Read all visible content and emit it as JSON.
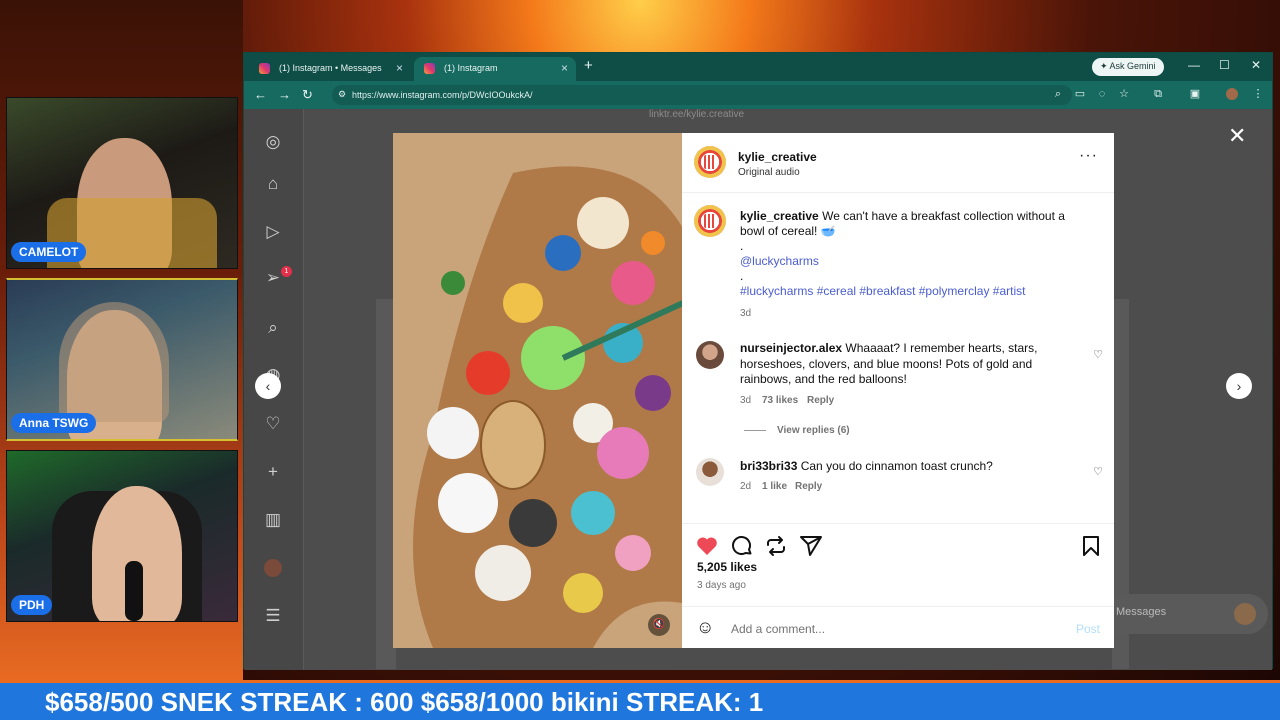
{
  "stream": {
    "cams": [
      {
        "label": "CAMELOT"
      },
      {
        "label": "Anna TSWG"
      },
      {
        "label": "PDH"
      }
    ],
    "ticker": "$658/500 SNEK STREAK : 600 $658/1000 bikini STREAK: 1"
  },
  "browser": {
    "tabs": [
      {
        "title": "(1) Instagram • Messages",
        "active": false
      },
      {
        "title": "(1) Instagram",
        "active": true
      }
    ],
    "new_tab": "+",
    "ask_gemini": "Ask Gemini",
    "url": "https://www.instagram.com/p/DWcIOOukckA/"
  },
  "instagram": {
    "profile_link_partial": "linktr.ee/kylie.creative",
    "notification_count": "1",
    "post": {
      "username": "kylie_creative",
      "audio": "Original audio",
      "caption": {
        "username": "kylie_creative",
        "text": "We can't have a breakfast collection without a bowl of cereal! 🥣",
        "dot": ".",
        "mention": "@luckycharms",
        "dot2": ".",
        "hashtags": "#luckycharms #cereal #breakfast #polymerclay #artist",
        "age": "3d"
      },
      "comments": [
        {
          "username": "nurseinjector.alex",
          "text": "Whaaaat? I remember hearts, stars, horseshoes, clovers, and blue moons! Pots of gold and rainbows, and the red balloons!",
          "age": "3d",
          "likes": "73 likes",
          "reply": "Reply",
          "view_replies": "View replies (6)"
        },
        {
          "username": "bri33bri33",
          "text": "Can you do cinnamon toast crunch?",
          "age": "2d",
          "likes": "1 like",
          "reply": "Reply"
        }
      ],
      "like_count": "5,205 likes",
      "posted": "3 days ago",
      "comment_placeholder": "Add a comment...",
      "post_button": "Post"
    },
    "messages_pill": "Messages"
  },
  "colors": {
    "accent_blue": "#1f76dc",
    "like_red": "#ed4956",
    "link": "#4a5dcf",
    "browser_teal": "#0f4e47"
  }
}
